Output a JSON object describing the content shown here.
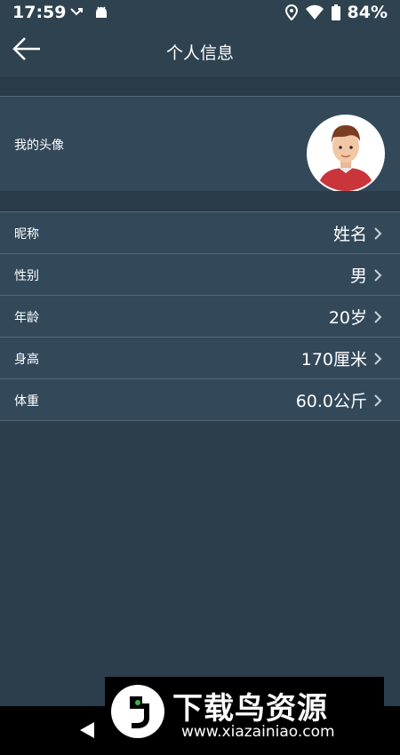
{
  "status_bar": {
    "time": "17:59",
    "battery": "84%"
  },
  "header": {
    "title": "个人信息"
  },
  "avatar_row": {
    "label": "我的头像"
  },
  "info_rows": [
    {
      "label": "昵称",
      "value": "姓名"
    },
    {
      "label": "性别",
      "value": "男"
    },
    {
      "label": "年龄",
      "value": "20岁"
    },
    {
      "label": "身高",
      "value": "170厘米"
    },
    {
      "label": "体重",
      "value": "60.0公斤"
    }
  ],
  "watermark": {
    "title": "下载鸟资源",
    "url": "www.xiazainiao.com"
  },
  "colors": {
    "background": "#2c3d4c",
    "row": "#33495a",
    "divider": "#556776",
    "bar": "#2f4250"
  }
}
